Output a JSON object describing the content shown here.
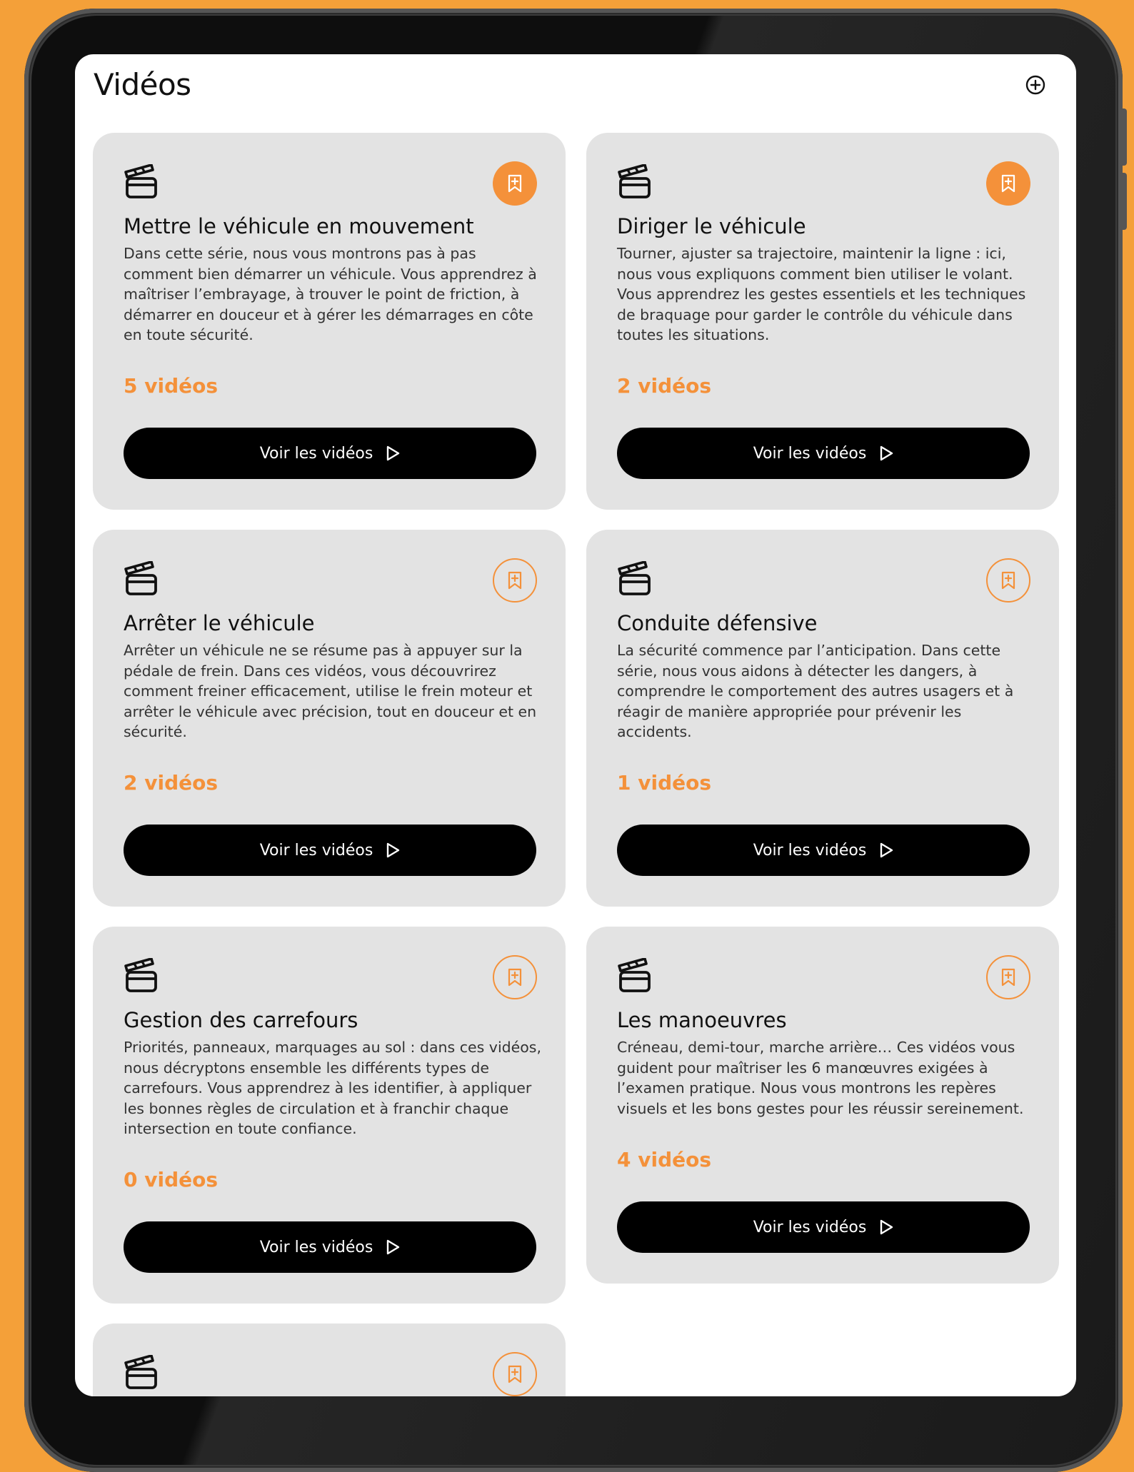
{
  "header": {
    "title": "Vidéos",
    "add_icon": "plus-circle-icon"
  },
  "colors": {
    "accent": "#F4913A",
    "card_bg": "#E3E3E3",
    "button_bg": "#000000",
    "page_bg": "#F4A039"
  },
  "cards": [
    {
      "title": "Mettre le véhicule en mouvement",
      "description": "Dans cette série, nous vous montrons pas à pas comment bien démarrer un véhicule. Vous apprendrez à maîtriser l’embrayage, à trouver le point de friction, à démarrer en douceur et à gérer les démarrages en côte en toute sécurité.",
      "count": "5 vidéos",
      "button_label": "Voir les vidéos",
      "bookmarked": true
    },
    {
      "title": "Diriger le véhicule",
      "description": "Tourner, ajuster sa trajectoire, maintenir la ligne : ici, nous vous expliquons comment bien utiliser le volant. Vous apprendrez les gestes essentiels et les techniques de braquage pour garder le contrôle du véhicule dans toutes les situations.",
      "count": "2 vidéos",
      "button_label": "Voir les vidéos",
      "bookmarked": true
    },
    {
      "title": "Arrêter le véhicule",
      "description": "Arrêter un véhicule ne se résume pas à appuyer sur la pédale de frein. Dans ces vidéos, vous découvrirez comment freiner efficacement, utilise le frein moteur et arrêter le véhicule avec précision, tout en douceur et en sécurité.",
      "count": "2 vidéos",
      "button_label": "Voir les vidéos",
      "bookmarked": false
    },
    {
      "title": "Conduite défensive",
      "description": "La sécurité commence par l’anticipation. Dans cette série, nous vous aidons à détecter les dangers, à comprendre le comportement des autres usagers et à réagir de manière appropriée pour prévenir les accidents.",
      "count": "1 vidéos",
      "button_label": "Voir les vidéos",
      "bookmarked": false
    },
    {
      "title": "Gestion des carrefours",
      "description": "Priorités, panneaux, marquages au sol : dans ces vidéos, nous décryptons ensemble les différents types de carrefours. Vous apprendrez à les identifier, à appliquer les bonnes règles de circulation et à franchir chaque intersection en toute confiance.",
      "count": "0 vidéos",
      "button_label": "Voir les vidéos",
      "bookmarked": false
    },
    {
      "title": "Les manoeuvres",
      "description": "Créneau, demi-tour, marche arrière… Ces vidéos vous guident pour maîtriser les 6 manœuvres exigées à l’examen pratique. Nous vous montrons les repères visuels et les bons gestes pour les réussir sereinement.",
      "count": "4 vidéos",
      "button_label": "Voir les vidéos",
      "bookmarked": false
    },
    {
      "title": "",
      "description": "",
      "count": "",
      "button_label": "",
      "bookmarked": false
    }
  ]
}
